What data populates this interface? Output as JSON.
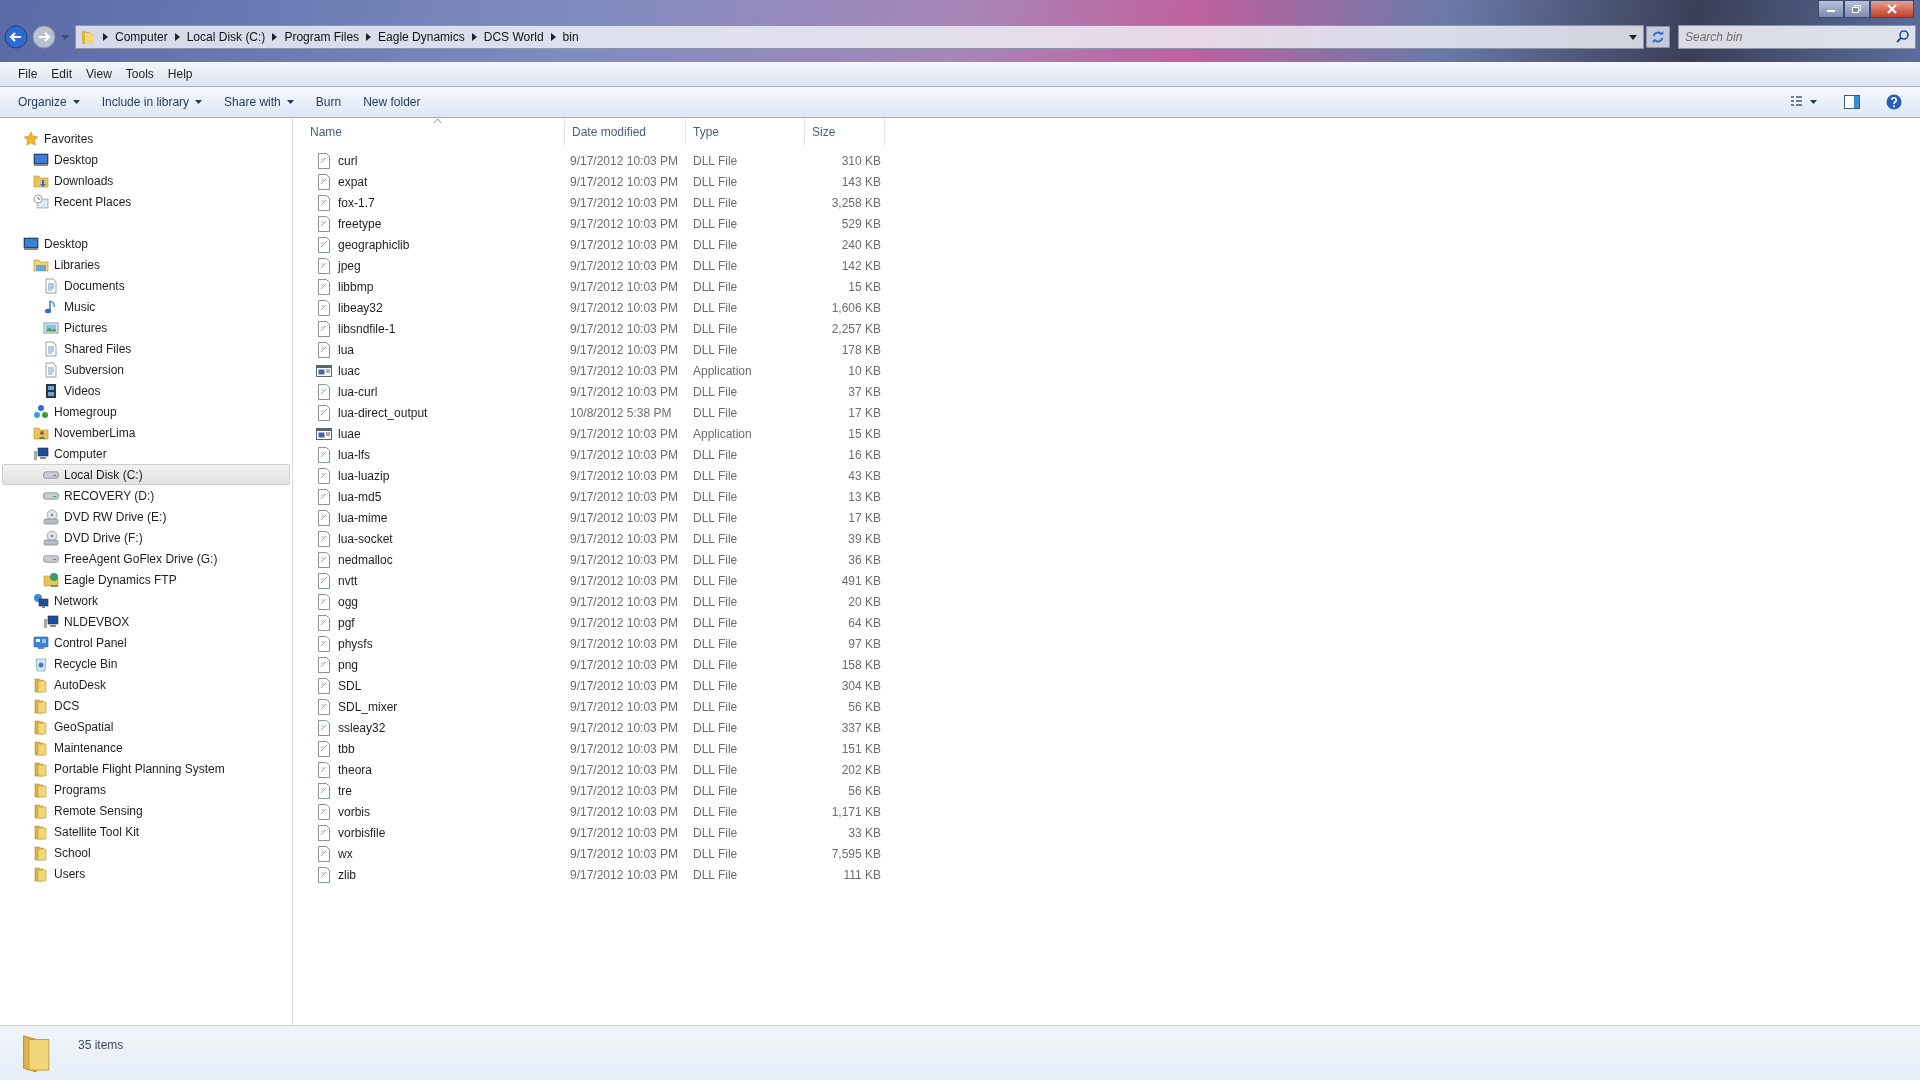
{
  "address_bar": {
    "crumbs": [
      "Computer",
      "Local Disk (C:)",
      "Program Files",
      "Eagle Dynamics",
      "DCS World",
      "bin"
    ],
    "search": {
      "placeholder": "Search bin"
    }
  },
  "menu_bar": [
    "File",
    "Edit",
    "View",
    "Tools",
    "Help"
  ],
  "toolbar": [
    {
      "label": "Organize",
      "dropdown": true
    },
    {
      "label": "Include in library",
      "dropdown": true
    },
    {
      "label": "Share with",
      "dropdown": true
    },
    {
      "label": "Burn",
      "dropdown": false
    },
    {
      "label": "New folder",
      "dropdown": false
    }
  ],
  "sidebar": {
    "items": [
      {
        "label": "Favorites",
        "kind": "star",
        "selected": false,
        "children": [
          {
            "label": "Desktop",
            "kind": "monitor",
            "selected": false
          },
          {
            "label": "Downloads",
            "kind": "downloads",
            "selected": false
          },
          {
            "label": "Recent Places",
            "kind": "recent",
            "selected": false
          }
        ]
      },
      {
        "label": "Desktop",
        "kind": "monitor",
        "selected": false,
        "children": [
          {
            "label": "Libraries",
            "kind": "library",
            "selected": false,
            "children": [
              {
                "label": "Documents",
                "kind": "document",
                "selected": false
              },
              {
                "label": "Music",
                "kind": "music",
                "selected": false
              },
              {
                "label": "Pictures",
                "kind": "picture",
                "selected": false
              },
              {
                "label": "Shared Files",
                "kind": "document",
                "selected": false
              },
              {
                "label": "Subversion",
                "kind": "document",
                "selected": false
              },
              {
                "label": "Videos",
                "kind": "video",
                "selected": false
              }
            ]
          },
          {
            "label": "Homegroup",
            "kind": "homegroup",
            "selected": false
          },
          {
            "label": "NovemberLima",
            "kind": "user",
            "selected": false
          },
          {
            "label": "Computer",
            "kind": "computer",
            "selected": false,
            "children": [
              {
                "label": "Local Disk (C:)",
                "kind": "drive",
                "selected": true
              },
              {
                "label": "RECOVERY (D:)",
                "kind": "drive",
                "selected": false
              },
              {
                "label": "DVD RW Drive (E:)",
                "kind": "disc",
                "selected": false
              },
              {
                "label": "DVD Drive (F:)",
                "kind": "disc",
                "selected": false
              },
              {
                "label": "FreeAgent GoFlex Drive (G:)",
                "kind": "drive",
                "selected": false
              },
              {
                "label": "Eagle Dynamics FTP",
                "kind": "ftp",
                "selected": false
              }
            ]
          },
          {
            "label": "Network",
            "kind": "network",
            "selected": false,
            "children": [
              {
                "label": "NLDEVBOX",
                "kind": "computer",
                "selected": false
              }
            ]
          },
          {
            "label": "Control Panel",
            "kind": "control",
            "selected": false
          },
          {
            "label": "Recycle Bin",
            "kind": "bin",
            "selected": false
          },
          {
            "label": "AutoDesk",
            "kind": "folder",
            "selected": false
          },
          {
            "label": "DCS",
            "kind": "folder",
            "selected": false
          },
          {
            "label": "GeoSpatial",
            "kind": "folder",
            "selected": false
          },
          {
            "label": "Maintenance",
            "kind": "folder",
            "selected": false
          },
          {
            "label": "Portable Flight Planning System",
            "kind": "folder",
            "selected": false
          },
          {
            "label": "Programs",
            "kind": "folder",
            "selected": false
          },
          {
            "label": "Remote Sensing",
            "kind": "folder",
            "selected": false
          },
          {
            "label": "Satellite Tool Kit",
            "kind": "folder",
            "selected": false
          },
          {
            "label": "School",
            "kind": "folder",
            "selected": false
          },
          {
            "label": "Users",
            "kind": "folder",
            "selected": false
          }
        ]
      }
    ]
  },
  "file_list": {
    "columns": [
      {
        "label": "Name",
        "sorted": true
      },
      {
        "label": "Date modified",
        "sorted": false
      },
      {
        "label": "Type",
        "sorted": false
      },
      {
        "label": "Size",
        "sorted": false
      }
    ],
    "rows": [
      {
        "name": "curl",
        "kind": "dll",
        "date": "9/17/2012 10:03 PM",
        "type": "DLL File",
        "size": "310 KB"
      },
      {
        "name": "expat",
        "kind": "dll",
        "date": "9/17/2012 10:03 PM",
        "type": "DLL File",
        "size": "143 KB"
      },
      {
        "name": "fox-1.7",
        "kind": "dll",
        "date": "9/17/2012 10:03 PM",
        "type": "DLL File",
        "size": "3,258 KB"
      },
      {
        "name": "freetype",
        "kind": "dll",
        "date": "9/17/2012 10:03 PM",
        "type": "DLL File",
        "size": "529 KB"
      },
      {
        "name": "geographiclib",
        "kind": "dll",
        "date": "9/17/2012 10:03 PM",
        "type": "DLL File",
        "size": "240 KB"
      },
      {
        "name": "jpeg",
        "kind": "dll",
        "date": "9/17/2012 10:03 PM",
        "type": "DLL File",
        "size": "142 KB"
      },
      {
        "name": "libbmp",
        "kind": "dll",
        "date": "9/17/2012 10:03 PM",
        "type": "DLL File",
        "size": "15 KB"
      },
      {
        "name": "libeay32",
        "kind": "dll",
        "date": "9/17/2012 10:03 PM",
        "type": "DLL File",
        "size": "1,606 KB"
      },
      {
        "name": "libsndfile-1",
        "kind": "dll",
        "date": "9/17/2012 10:03 PM",
        "type": "DLL File",
        "size": "2,257 KB"
      },
      {
        "name": "lua",
        "kind": "dll",
        "date": "9/17/2012 10:03 PM",
        "type": "DLL File",
        "size": "178 KB"
      },
      {
        "name": "luac",
        "kind": "app",
        "date": "9/17/2012 10:03 PM",
        "type": "Application",
        "size": "10 KB"
      },
      {
        "name": "lua-curl",
        "kind": "dll",
        "date": "9/17/2012 10:03 PM",
        "type": "DLL File",
        "size": "37 KB"
      },
      {
        "name": "lua-direct_output",
        "kind": "dll",
        "date": "10/8/2012 5:38 PM",
        "type": "DLL File",
        "size": "17 KB"
      },
      {
        "name": "luae",
        "kind": "app",
        "date": "9/17/2012 10:03 PM",
        "type": "Application",
        "size": "15 KB"
      },
      {
        "name": "lua-lfs",
        "kind": "dll",
        "date": "9/17/2012 10:03 PM",
        "type": "DLL File",
        "size": "16 KB"
      },
      {
        "name": "lua-luazip",
        "kind": "dll",
        "date": "9/17/2012 10:03 PM",
        "type": "DLL File",
        "size": "43 KB"
      },
      {
        "name": "lua-md5",
        "kind": "dll",
        "date": "9/17/2012 10:03 PM",
        "type": "DLL File",
        "size": "13 KB"
      },
      {
        "name": "lua-mime",
        "kind": "dll",
        "date": "9/17/2012 10:03 PM",
        "type": "DLL File",
        "size": "17 KB"
      },
      {
        "name": "lua-socket",
        "kind": "dll",
        "date": "9/17/2012 10:03 PM",
        "type": "DLL File",
        "size": "39 KB"
      },
      {
        "name": "nedmalloc",
        "kind": "dll",
        "date": "9/17/2012 10:03 PM",
        "type": "DLL File",
        "size": "36 KB"
      },
      {
        "name": "nvtt",
        "kind": "dll",
        "date": "9/17/2012 10:03 PM",
        "type": "DLL File",
        "size": "491 KB"
      },
      {
        "name": "ogg",
        "kind": "dll",
        "date": "9/17/2012 10:03 PM",
        "type": "DLL File",
        "size": "20 KB"
      },
      {
        "name": "pgf",
        "kind": "dll",
        "date": "9/17/2012 10:03 PM",
        "type": "DLL File",
        "size": "64 KB"
      },
      {
        "name": "physfs",
        "kind": "dll",
        "date": "9/17/2012 10:03 PM",
        "type": "DLL File",
        "size": "97 KB"
      },
      {
        "name": "png",
        "kind": "dll",
        "date": "9/17/2012 10:03 PM",
        "type": "DLL File",
        "size": "158 KB"
      },
      {
        "name": "SDL",
        "kind": "dll",
        "date": "9/17/2012 10:03 PM",
        "type": "DLL File",
        "size": "304 KB"
      },
      {
        "name": "SDL_mixer",
        "kind": "dll",
        "date": "9/17/2012 10:03 PM",
        "type": "DLL File",
        "size": "56 KB"
      },
      {
        "name": "ssleay32",
        "kind": "dll",
        "date": "9/17/2012 10:03 PM",
        "type": "DLL File",
        "size": "337 KB"
      },
      {
        "name": "tbb",
        "kind": "dll",
        "date": "9/17/2012 10:03 PM",
        "type": "DLL File",
        "size": "151 KB"
      },
      {
        "name": "theora",
        "kind": "dll",
        "date": "9/17/2012 10:03 PM",
        "type": "DLL File",
        "size": "202 KB"
      },
      {
        "name": "tre",
        "kind": "dll",
        "date": "9/17/2012 10:03 PM",
        "type": "DLL File",
        "size": "56 KB"
      },
      {
        "name": "vorbis",
        "kind": "dll",
        "date": "9/17/2012 10:03 PM",
        "type": "DLL File",
        "size": "1,171 KB"
      },
      {
        "name": "vorbisfile",
        "kind": "dll",
        "date": "9/17/2012 10:03 PM",
        "type": "DLL File",
        "size": "33 KB"
      },
      {
        "name": "wx",
        "kind": "dll",
        "date": "9/17/2012 10:03 PM",
        "type": "DLL File",
        "size": "7,595 KB"
      },
      {
        "name": "zlib",
        "kind": "dll",
        "date": "9/17/2012 10:03 PM",
        "type": "DLL File",
        "size": "111 KB"
      }
    ]
  },
  "status_bar": {
    "item_count": "35 items"
  }
}
